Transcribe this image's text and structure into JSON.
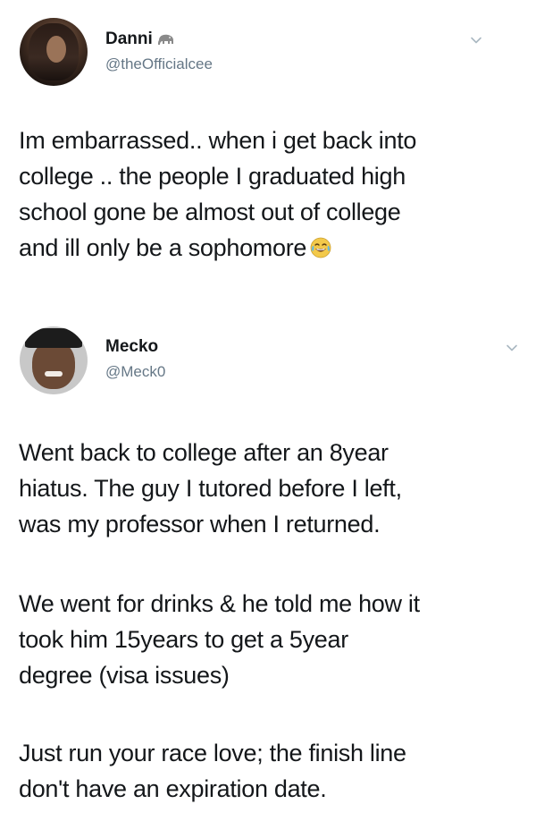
{
  "tweets": [
    {
      "name": "Danni",
      "handle": "@theOfficialcee",
      "badge_icon": "elephant-icon",
      "lines": [
        "Im embarrassed.. when i get back into",
        "college .. the people I graduated high",
        "school gone be almost out of college",
        "and ill only be a sophomore"
      ],
      "trailing_emoji": "face-with-tears-of-joy-icon"
    },
    {
      "name": "Mecko",
      "handle": "@Meck0",
      "paragraphs": [
        [
          "Went back to college after an 8year",
          "hiatus. The guy I tutored before I left,",
          "was my professor when I returned."
        ],
        [
          "We went for drinks & he told me how it",
          "took him 15years to get a 5year",
          "degree (visa issues)"
        ],
        [
          "Just run your race love; the finish line",
          "don't have an expiration date."
        ]
      ]
    }
  ]
}
